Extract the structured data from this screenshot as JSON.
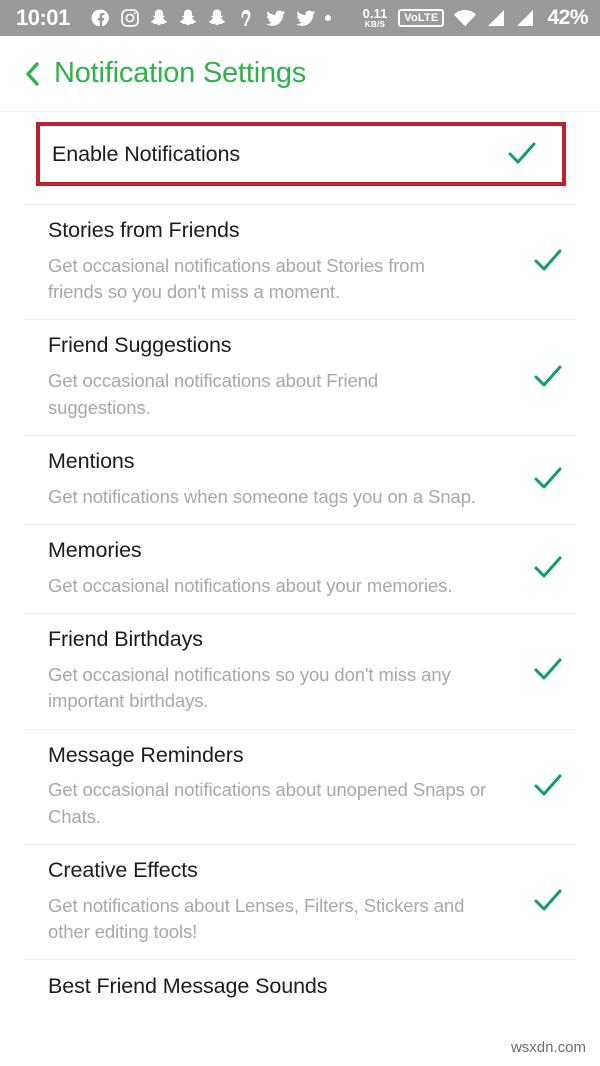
{
  "status_bar": {
    "clock": "10:01",
    "left_icons": [
      "facebook-icon",
      "instagram-icon",
      "snapchat-icon",
      "snapchat-icon",
      "snapchat-icon",
      "snapchat-drop-icon",
      "twitter-icon",
      "twitter-icon",
      "dot-icon"
    ],
    "network_speed_value": "0.11",
    "network_speed_unit": "KB/S",
    "volte_label": "VoLTE",
    "right_icons": [
      "wifi-icon",
      "signal-icon",
      "signal-icon"
    ],
    "battery": "42%",
    "background_color": "#9a9a9a"
  },
  "header": {
    "back_icon": "chevron-left-icon",
    "title": "Notification Settings",
    "accent_color": "#2eb24c"
  },
  "colors": {
    "check_green": "#0f9d6e",
    "highlight_red": "#c0202e",
    "title_text": "#1c1c1c",
    "sub_text": "#a8a8a8",
    "divider": "#eeeeee"
  },
  "highlight": {
    "target": "Enable Notifications",
    "border_color": "#c0202e"
  },
  "settings": [
    {
      "title": "Enable Notifications",
      "description": "",
      "checked": true,
      "highlighted": true
    },
    {
      "title": "Stories from Friends",
      "description": "Get occasional notifications about Stories from friends so you don't miss a moment.",
      "checked": true,
      "highlighted": false
    },
    {
      "title": "Friend Suggestions",
      "description": "Get occasional notifications about Friend suggestions.",
      "checked": true,
      "highlighted": false
    },
    {
      "title": "Mentions",
      "description": "Get notifications when someone tags you on a Snap.",
      "checked": true,
      "highlighted": false
    },
    {
      "title": "Memories",
      "description": "Get occasional notifications about your memories.",
      "checked": true,
      "highlighted": false
    },
    {
      "title": "Friend Birthdays",
      "description": "Get occasional notifications so you don't miss any important birthdays.",
      "checked": true,
      "highlighted": false
    },
    {
      "title": "Message Reminders",
      "description": "Get occasional notifications about unopened Snaps or Chats.",
      "checked": true,
      "highlighted": false
    },
    {
      "title": "Creative Effects",
      "description": "Get notifications about Lenses, Filters, Stickers and other editing tools!",
      "checked": true,
      "highlighted": false
    },
    {
      "title": "Best Friend Message Sounds",
      "description": "",
      "checked": false,
      "highlighted": false
    }
  ],
  "watermark": "wsxdn.com"
}
